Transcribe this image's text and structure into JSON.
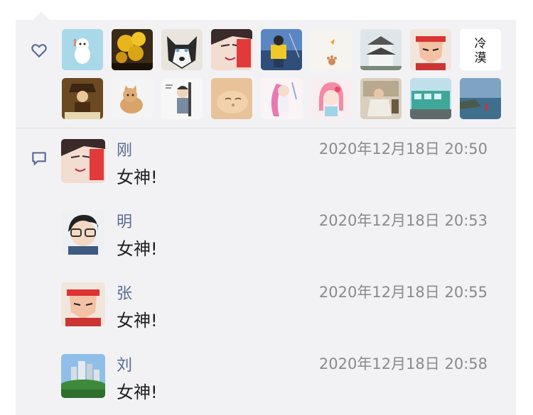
{
  "likes": {
    "icon": "heart-icon",
    "users": [
      "user-1",
      "user-2",
      "user-3",
      "user-4",
      "user-5",
      "user-6",
      "user-7",
      "user-8",
      "user-9",
      "user-10",
      "user-11",
      "user-12",
      "user-13",
      "user-14",
      "user-15",
      "user-16",
      "user-17",
      "user-18"
    ]
  },
  "thumb_text": {
    "lengmo": "冷漠"
  },
  "comments_icon": "comment-icon",
  "comments": [
    {
      "name": "刚",
      "time": "2020年12月18日 20:50",
      "text": "女神!"
    },
    {
      "name": "明",
      "time": "2020年12月18日 20:53",
      "text": "女神!"
    },
    {
      "name": "张",
      "time": "2020年12月18日 20:55",
      "text": "女神!"
    },
    {
      "name": "刘",
      "time": "2020年12月18日 20:58",
      "text": "女神!"
    }
  ],
  "colors": {
    "name": "#5a6b96",
    "panel": "#f2f2f4",
    "time": "#8a8a8a"
  }
}
